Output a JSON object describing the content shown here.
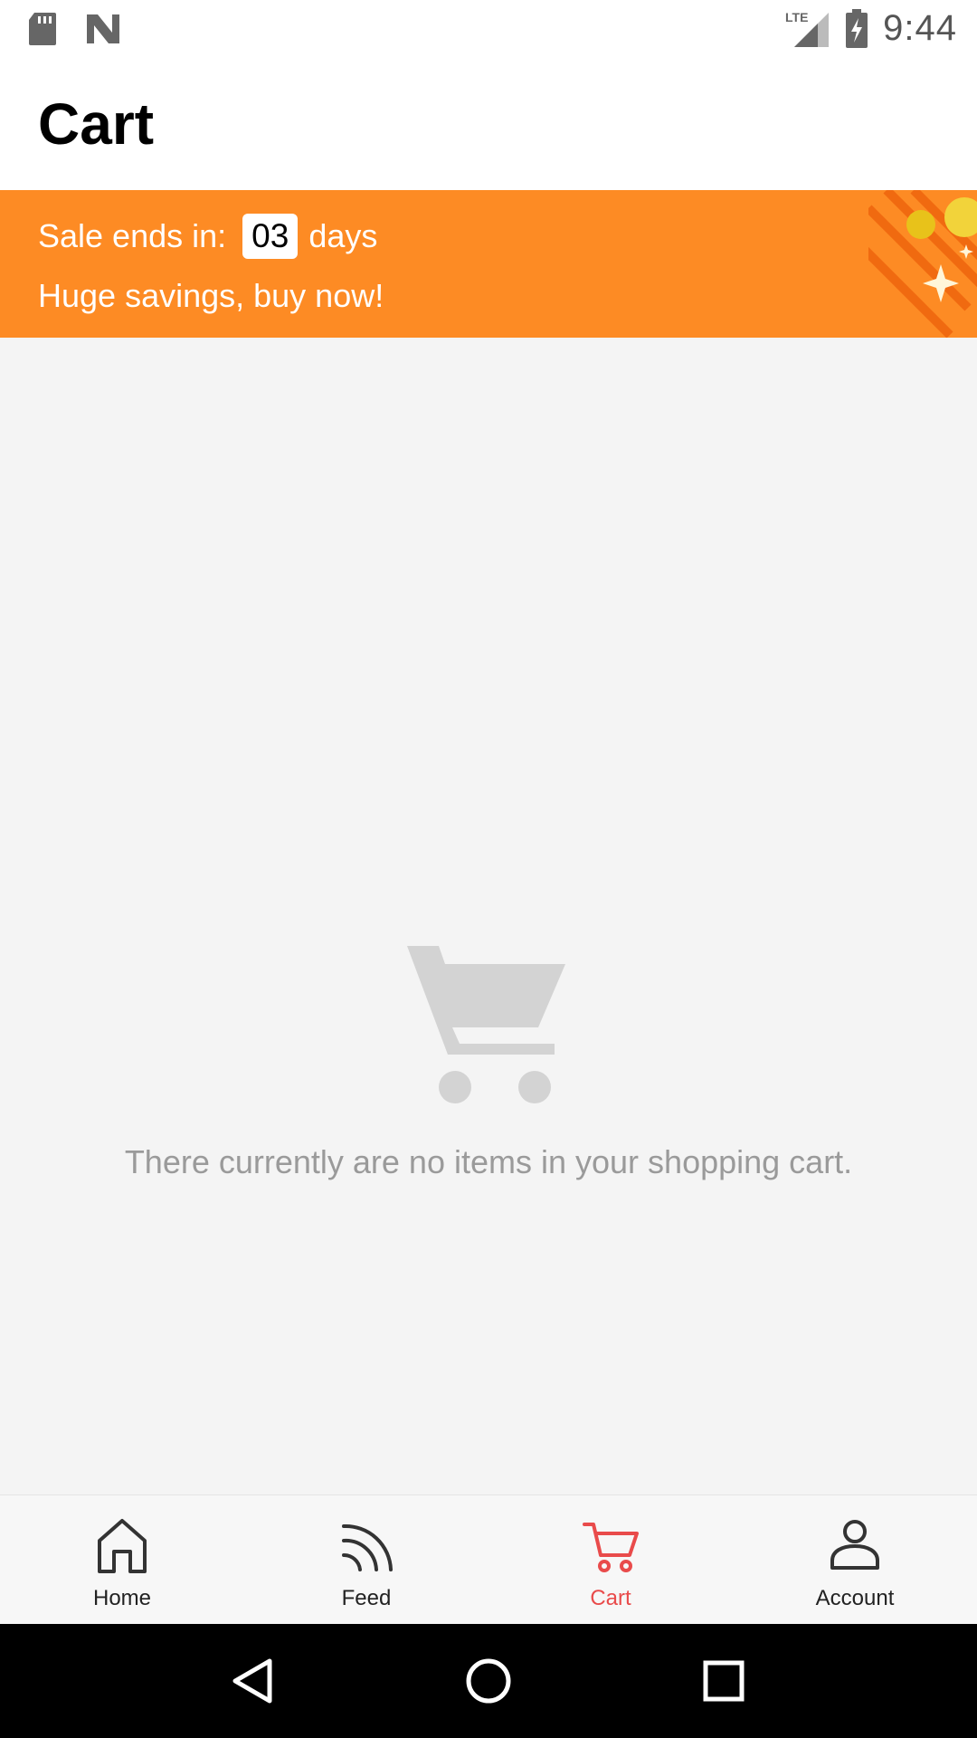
{
  "status_bar": {
    "time": "9:44",
    "network": "LTE",
    "icons": [
      "sd-card-icon",
      "n-logo-icon",
      "lte-signal-icon",
      "battery-charging-icon"
    ]
  },
  "header": {
    "title": "Cart"
  },
  "sale_banner": {
    "prefix": "Sale ends in:",
    "countdown_value": "03",
    "suffix": "days",
    "subtitle": "Huge savings, buy now!",
    "background_color": "#fd8b24"
  },
  "empty_state": {
    "icon": "shopping-cart-icon",
    "message": "There currently are no items in your shopping cart."
  },
  "bottom_nav": {
    "active_color": "#e94b4b",
    "items": [
      {
        "label": "Home",
        "icon": "home-icon",
        "active": false
      },
      {
        "label": "Feed",
        "icon": "feed-icon",
        "active": false
      },
      {
        "label": "Cart",
        "icon": "cart-icon",
        "active": true
      },
      {
        "label": "Account",
        "icon": "account-icon",
        "active": false
      }
    ]
  },
  "system_nav": {
    "icons": [
      "back-icon",
      "home-circle-icon",
      "recents-icon"
    ]
  }
}
